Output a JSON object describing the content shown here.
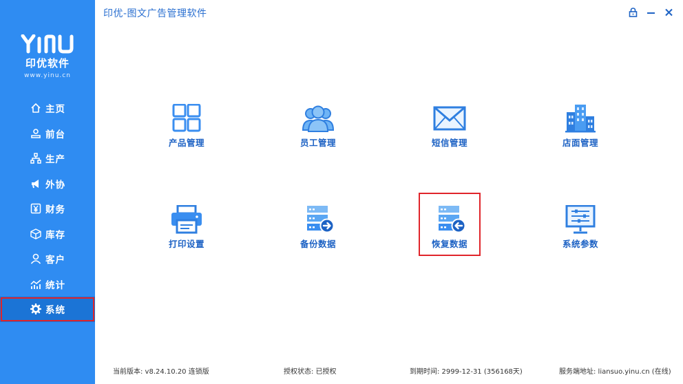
{
  "app": {
    "title": "印优-图文广告管理软件",
    "logo_text": "YINU",
    "logo_cn": "印优软件",
    "logo_url": "www.yinu.cn"
  },
  "sidebar": {
    "items": [
      {
        "label": "主页",
        "icon": "home-icon"
      },
      {
        "label": "前台",
        "icon": "user-desk-icon"
      },
      {
        "label": "生产",
        "icon": "hierarchy-icon"
      },
      {
        "label": "外协",
        "icon": "megaphone-icon"
      },
      {
        "label": "财务",
        "icon": "yen-icon"
      },
      {
        "label": "库存",
        "icon": "box-icon"
      },
      {
        "label": "客户",
        "icon": "person-icon"
      },
      {
        "label": "统计",
        "icon": "chart-icon"
      },
      {
        "label": "系统",
        "icon": "gear-icon"
      }
    ],
    "active_index": 8
  },
  "tiles": [
    {
      "label": "产品管理",
      "icon": "product-grid-icon"
    },
    {
      "label": "员工管理",
      "icon": "staff-group-icon"
    },
    {
      "label": "短信管理",
      "icon": "envelope-icon"
    },
    {
      "label": "店面管理",
      "icon": "building-icon"
    },
    {
      "label": "打印设置",
      "icon": "printer-icon"
    },
    {
      "label": "备份数据",
      "icon": "backup-server-icon"
    },
    {
      "label": "恢复数据",
      "icon": "restore-server-icon"
    },
    {
      "label": "系统参数",
      "icon": "monitor-settings-icon"
    }
  ],
  "selected_tile": "恢复数据",
  "status": {
    "version": "当前版本: v8.24.10.20  连锁版",
    "license": "授权状态: 已授权",
    "expiry": "到期时间: 2999-12-31 (356168天)",
    "server": "服务端地址: liansuo.yinu.cn (在线)"
  },
  "colors": {
    "sidebar": "#2f8cf2",
    "sidebar_active": "#1b74d6",
    "accent": "#1d62c4",
    "icon_light": "#4aa3f2",
    "highlight": "#e0242a"
  }
}
